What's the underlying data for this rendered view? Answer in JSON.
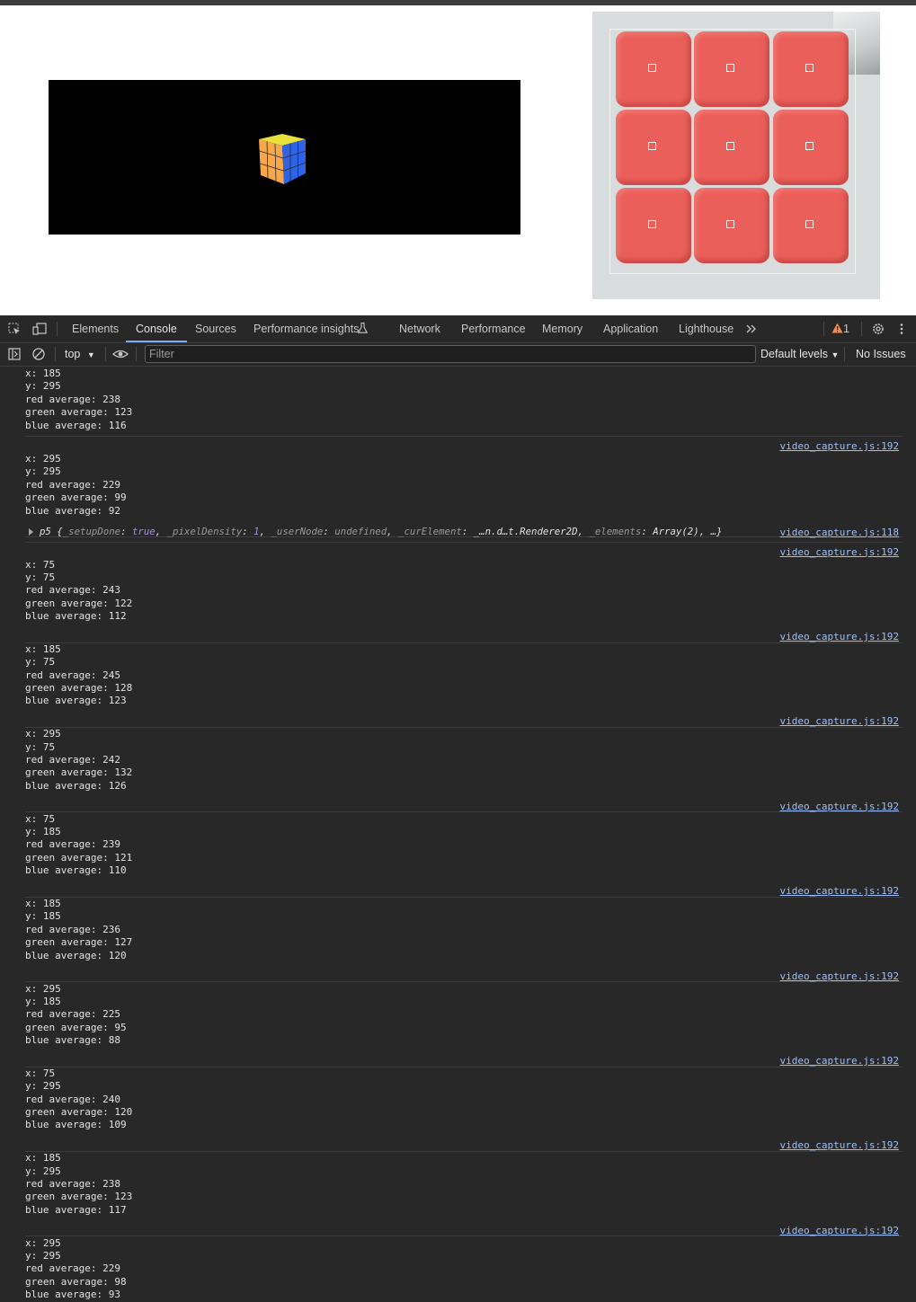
{
  "devtools": {
    "tabs": [
      "Elements",
      "Console",
      "Sources",
      "Performance insights",
      "Network",
      "Performance",
      "Memory",
      "Application",
      "Lighthouse"
    ],
    "active_tab": "Console",
    "more_tabs_icon": "chevron-double-right-icon",
    "warning_count": "1",
    "context": "top",
    "filter_placeholder": "Filter",
    "levels": "Default levels",
    "issues": "No Issues"
  },
  "video_preview": {
    "sticker_color": "#eb5f5a",
    "grid": "3x3"
  },
  "console": {
    "partial_source": "video_capture.js:192",
    "partial_entry": [
      "x: 185",
      "y: 295",
      "red average: 238",
      "green average: 123",
      "blue average: 116"
    ],
    "entries_before": [
      {
        "source": "video_capture.js:192",
        "lines": [
          "x: 295",
          "y: 295",
          "red average: 229",
          "green average: 99",
          "blue average: 92"
        ]
      }
    ],
    "object_log": {
      "source": "video_capture.js:118",
      "name": "p5",
      "props": [
        {
          "key": "_setupDone",
          "value": "true",
          "kind": "bool"
        },
        {
          "key": "_pixelDensity",
          "value": "1",
          "kind": "num"
        },
        {
          "key": "_userNode",
          "value": "undefined",
          "kind": "undef"
        },
        {
          "key": "_curElement",
          "value": "_…n.d…t.Renderer2D",
          "kind": "plain"
        },
        {
          "key": "_elements",
          "value": "Array(2)",
          "kind": "plain"
        }
      ],
      "tail": "…}"
    },
    "entries": [
      {
        "source": "video_capture.js:192",
        "lines": [
          "x: 75",
          "y: 75",
          "red average: 243",
          "green average: 122",
          "blue average: 112"
        ]
      },
      {
        "source": "video_capture.js:192",
        "lines": [
          "x: 185",
          "y: 75",
          "red average: 245",
          "green average: 128",
          "blue average: 123"
        ]
      },
      {
        "source": "video_capture.js:192",
        "lines": [
          "x: 295",
          "y: 75",
          "red average: 242",
          "green average: 132",
          "blue average: 126"
        ]
      },
      {
        "source": "video_capture.js:192",
        "lines": [
          "x: 75",
          "y: 185",
          "red average: 239",
          "green average: 121",
          "blue average: 110"
        ]
      },
      {
        "source": "video_capture.js:192",
        "lines": [
          "x: 185",
          "y: 185",
          "red average: 236",
          "green average: 127",
          "blue average: 120"
        ]
      },
      {
        "source": "video_capture.js:192",
        "lines": [
          "x: 295",
          "y: 185",
          "red average: 225",
          "green average: 95",
          "blue average: 88"
        ]
      },
      {
        "source": "video_capture.js:192",
        "lines": [
          "x: 75",
          "y: 295",
          "red average: 240",
          "green average: 120",
          "blue average: 109"
        ]
      },
      {
        "source": "video_capture.js:192",
        "lines": [
          "x: 185",
          "y: 295",
          "red average: 238",
          "green average: 123",
          "blue average: 117"
        ]
      },
      {
        "source": "video_capture.js:192",
        "lines": [
          "x: 295",
          "y: 295",
          "red average: 229",
          "green average: 98",
          "blue average: 93"
        ]
      }
    ]
  }
}
